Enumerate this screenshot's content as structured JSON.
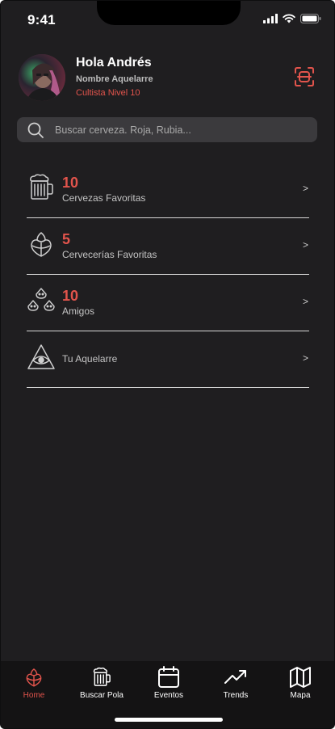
{
  "status_bar": {
    "time": "9:41"
  },
  "header": {
    "greeting": "Hola Andrés",
    "subtitle": "Nombre Aquelarre",
    "level": "Cultista Nivel 10"
  },
  "search": {
    "placeholder": "Buscar cerveza. Roja, Rubia..."
  },
  "list": [
    {
      "count": "10",
      "label": "Cervezas Favoritas",
      "chevron": ">",
      "icon": "beer-mug-icon"
    },
    {
      "count": "5",
      "label": "Cervecerías Favoritas",
      "chevron": ">",
      "icon": "hop-icon"
    },
    {
      "count": "10",
      "label": "Amigos",
      "chevron": ">",
      "icon": "friends-icon"
    },
    {
      "label": "Tu Aquelarre",
      "chevron": ">",
      "icon": "eye-triangle-icon"
    }
  ],
  "tabs": [
    {
      "label": "Home",
      "icon": "hop-icon",
      "active": true
    },
    {
      "label": "Buscar Pola",
      "icon": "beer-mug-icon",
      "active": false
    },
    {
      "label": "Eventos",
      "icon": "calendar-icon",
      "active": false
    },
    {
      "label": "Trends",
      "icon": "trend-up-icon",
      "active": false
    },
    {
      "label": "Mapa",
      "icon": "map-icon",
      "active": false
    }
  ],
  "colors": {
    "accent": "#e2544c",
    "background": "#1f1e20",
    "tabbar": "#141314",
    "search_bg": "#3b3a3d"
  }
}
